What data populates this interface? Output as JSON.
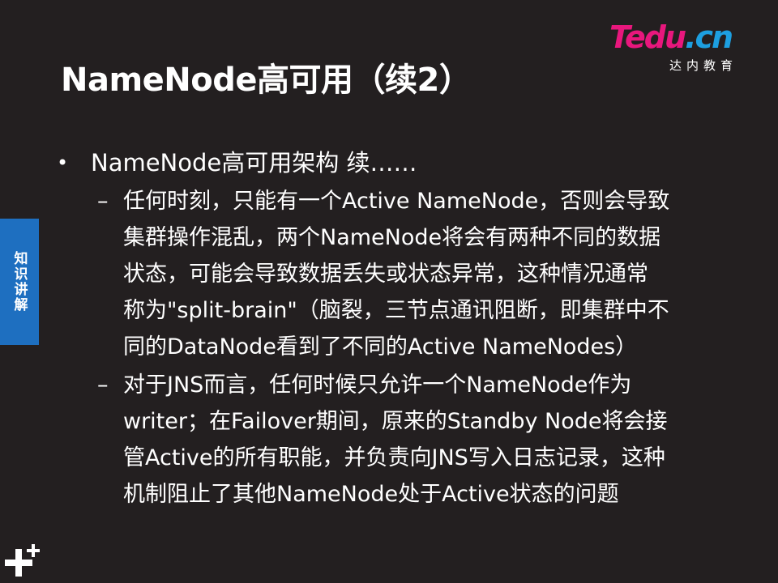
{
  "slide": {
    "title": "NameNode高可用（续2）"
  },
  "logo": {
    "te": "Te",
    "du": "du",
    "cn": ".cn",
    "subtitle": "达内教育"
  },
  "side_tab": {
    "label": "知识讲解"
  },
  "content": {
    "bullet": {
      "marker": "•",
      "text": "NameNode高可用架构 续……"
    },
    "subitems": [
      {
        "marker": "–",
        "lines": [
          "任何时刻，只能有一个Active  NameNode，否则会导致",
          "集群操作混乱，两个NameNode将会有两种不同的数据",
          "状态，可能会导致数据丢失或状态异常，这种情况通常",
          "称为\"split-brain\"（脑裂，三节点通讯阻断，即集群中不",
          "同的DataNode看到了不同的Active  NameNodes）"
        ]
      },
      {
        "marker": "–",
        "lines": [
          "对于JNS而言，任何时候只允许一个NameNode作为",
          "writer；在Failover期间，原来的Standby  Node将会接",
          "管Active的所有职能，并负责向JNS写入日志记录，这种",
          "机制阻止了其他NameNode处于Active状态的问题"
        ]
      }
    ]
  },
  "colors": {
    "background": "#231f20",
    "side_tab": "#1e6fc0",
    "logo_pink": "#e8177d",
    "logo_blue": "#1d9fe0"
  }
}
